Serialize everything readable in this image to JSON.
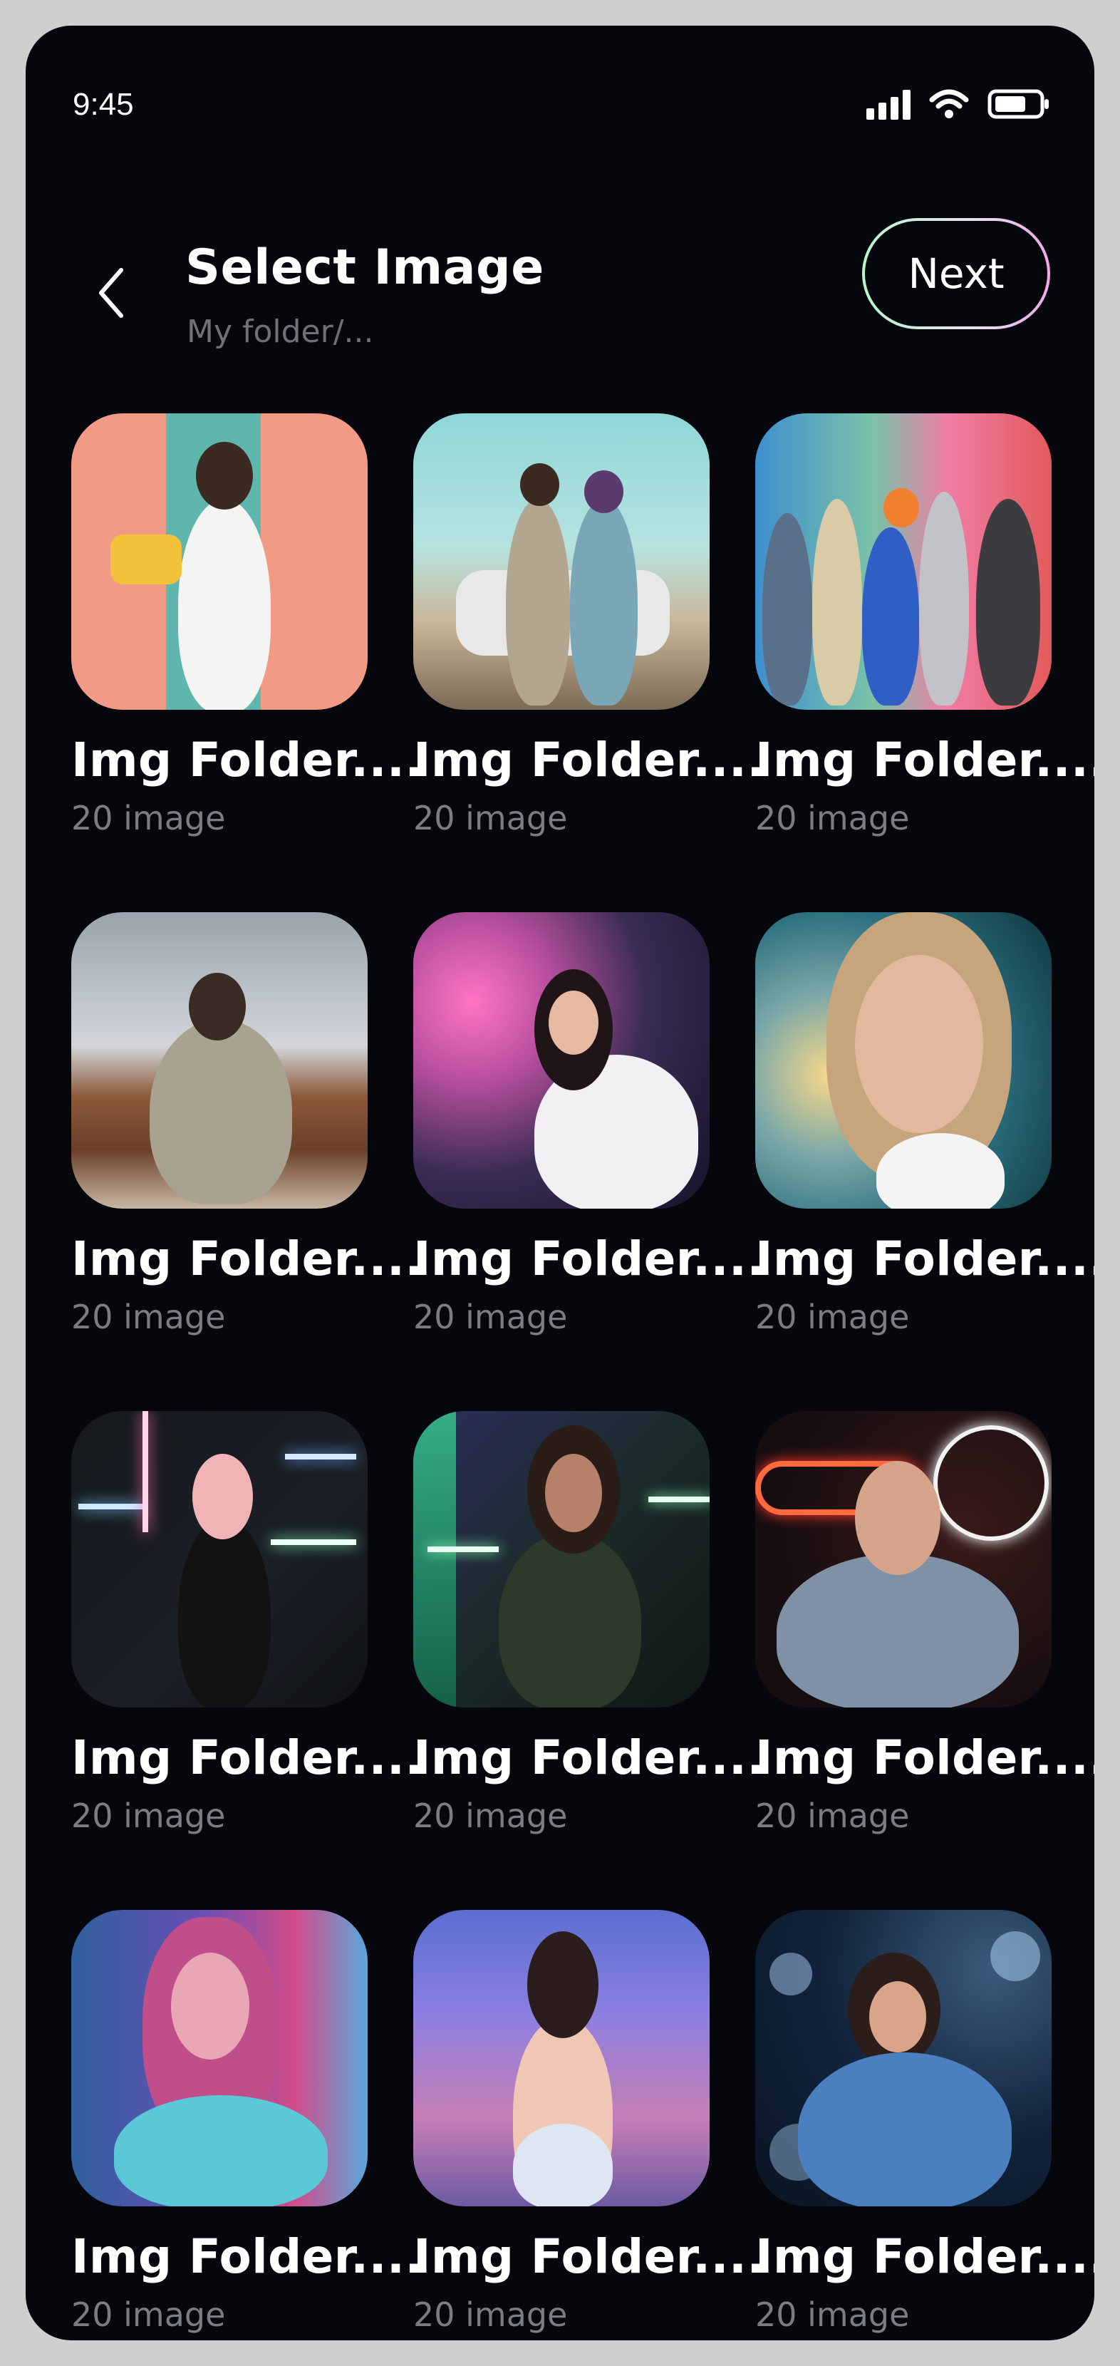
{
  "status_bar": {
    "time": "9:45",
    "icons": [
      "signal-icon",
      "wifi-icon",
      "battery-icon"
    ]
  },
  "header": {
    "back_icon": "chevron-left-icon",
    "title": "Select Image",
    "subtitle": "My folder/...",
    "next_label": "Next"
  },
  "colors": {
    "background": "#05070c",
    "accent_gradient_start": "#b7f5c8",
    "accent_gradient_end": "#f2a6ea",
    "muted_text": "#7a7d83"
  },
  "folders": [
    {
      "name": "Img Folder....",
      "count": "20 image"
    },
    {
      "name": "Img Folder....",
      "count": "20 image"
    },
    {
      "name": "Img Folder....",
      "count": "20 image"
    },
    {
      "name": "Img Folder....",
      "count": "20 image"
    },
    {
      "name": "Img Folder....",
      "count": "20 image"
    },
    {
      "name": "Img Folder....",
      "count": "20 image"
    },
    {
      "name": "Img Folder....",
      "count": "20 image"
    },
    {
      "name": "Img Folder....",
      "count": "20 image"
    },
    {
      "name": "Img Folder....",
      "count": "20 image"
    },
    {
      "name": "Img Folder....",
      "count": "20 image"
    },
    {
      "name": "Img Folder....",
      "count": "20 image"
    },
    {
      "name": "Img Folder....",
      "count": "20 image"
    }
  ]
}
